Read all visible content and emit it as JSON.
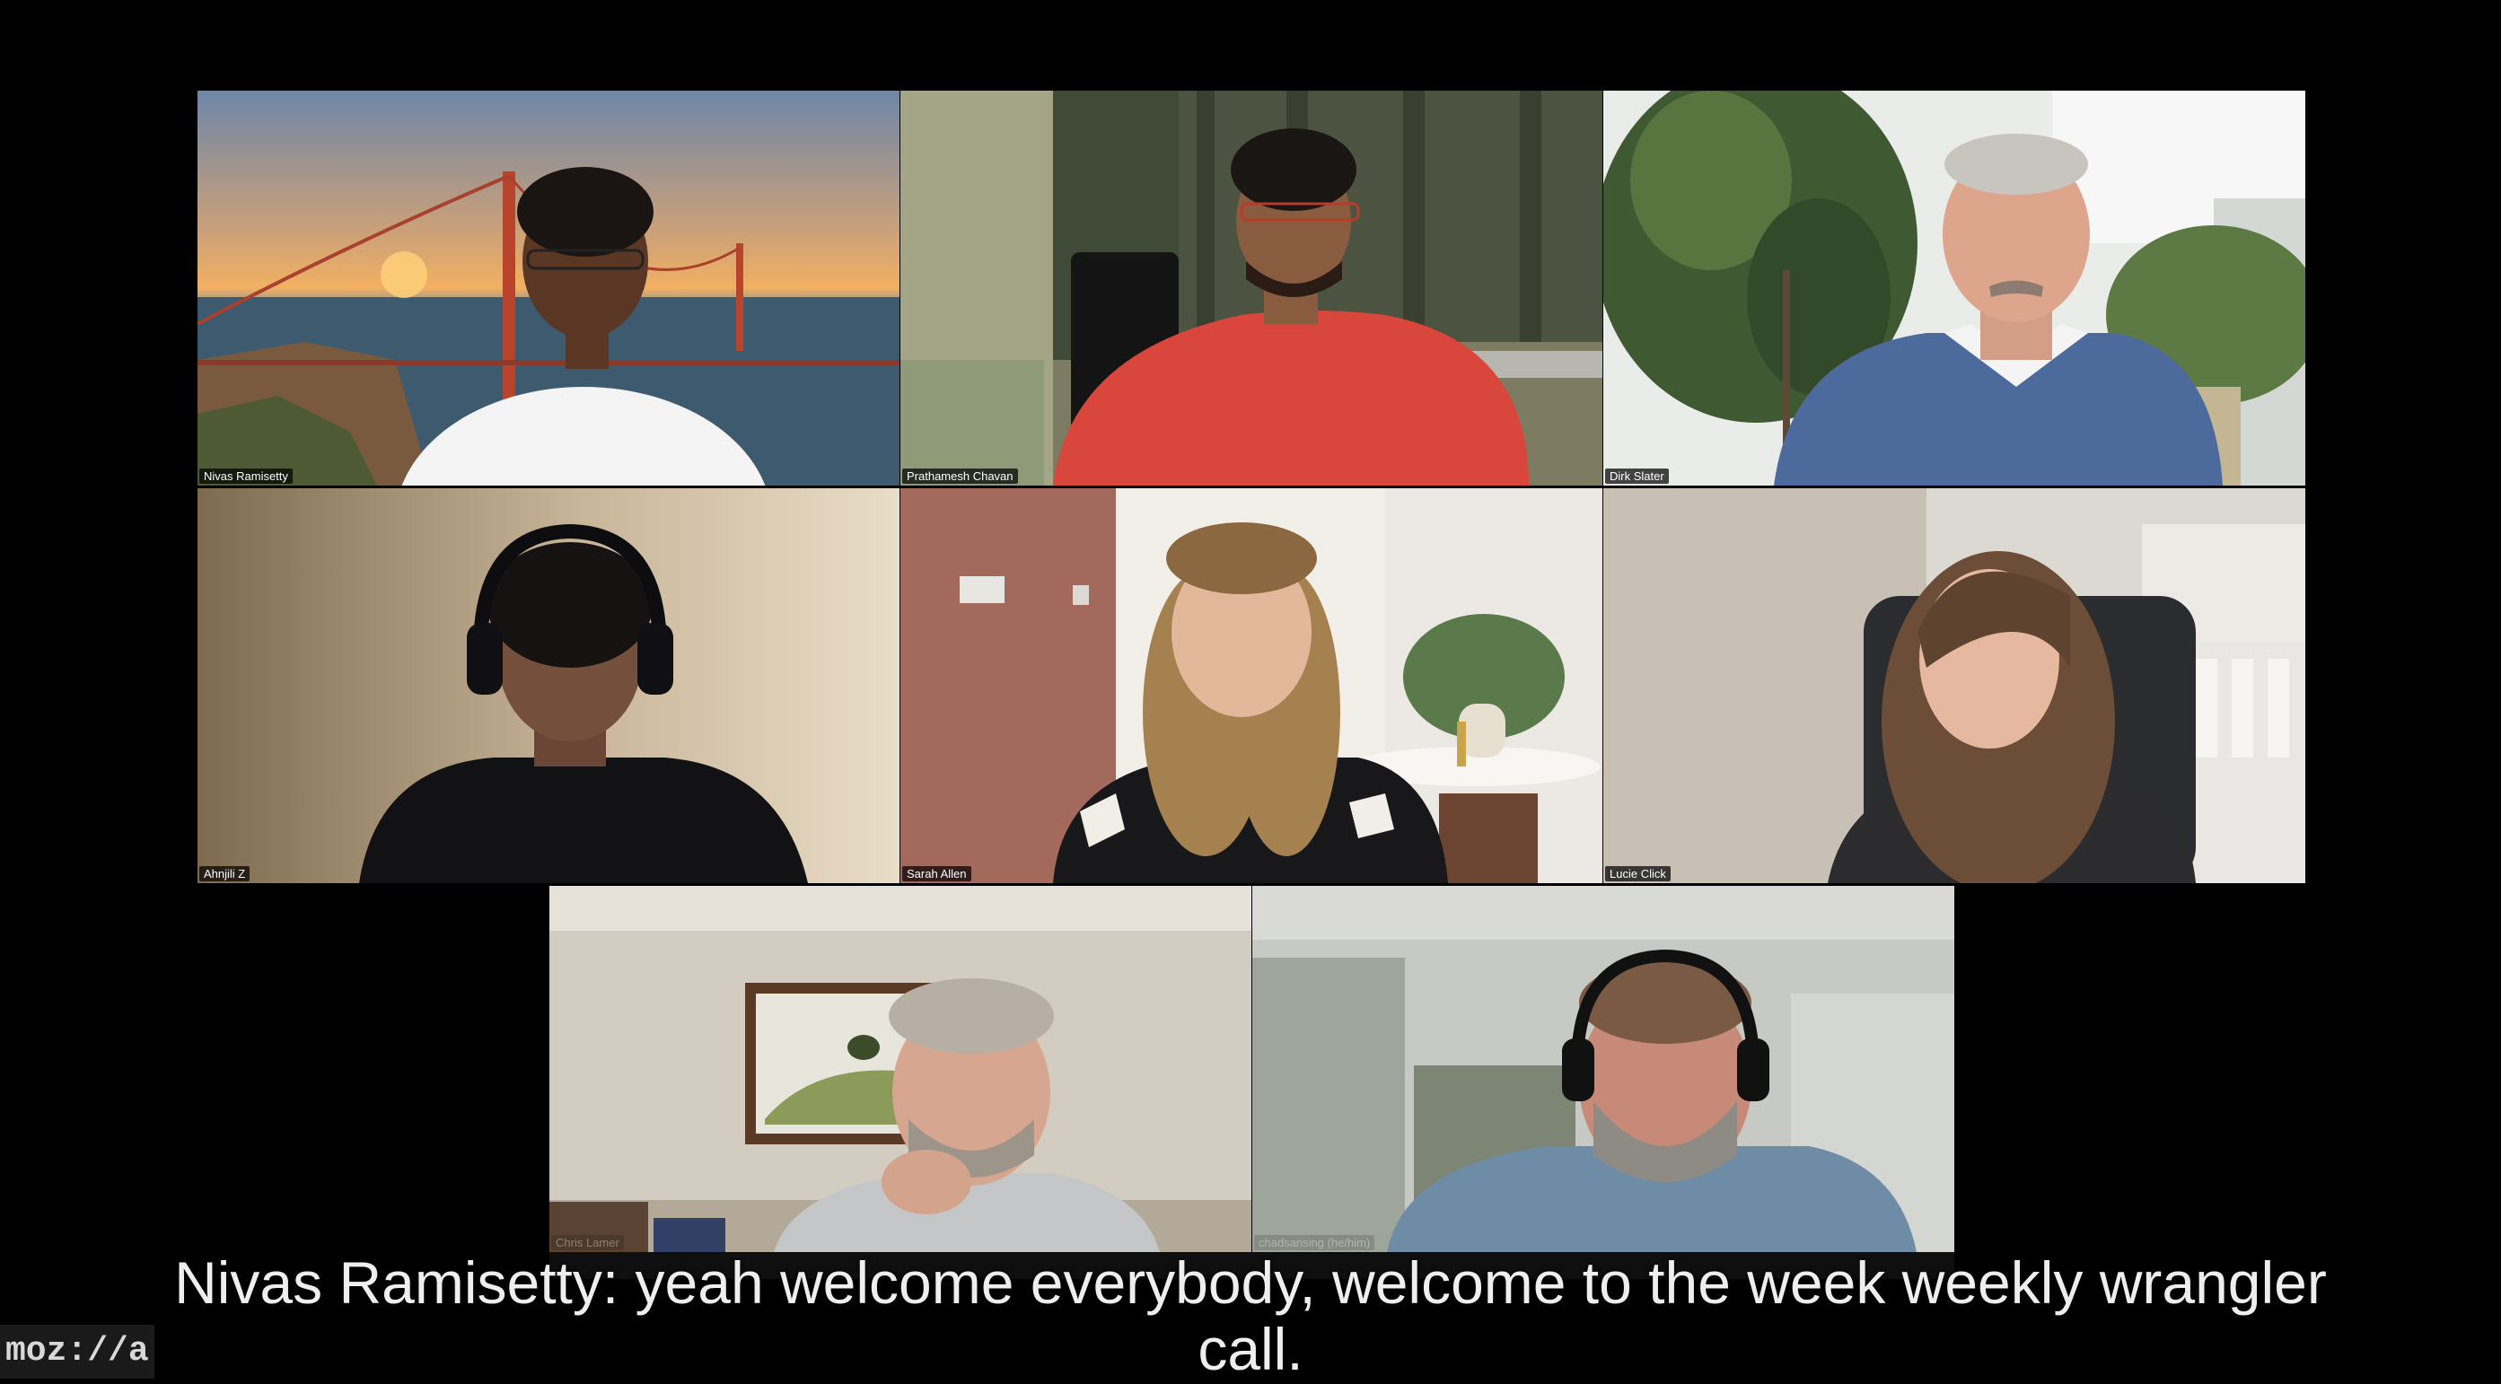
{
  "participants": [
    {
      "name": "Nivas Ramisetty"
    },
    {
      "name": "Prathamesh Chavan"
    },
    {
      "name": "Dirk Slater"
    },
    {
      "name": "Ahnjili Z"
    },
    {
      "name": "Sarah Allen"
    },
    {
      "name": "Lucie Click"
    },
    {
      "name": "Chris Lamer"
    },
    {
      "name": "chadsansing (he/him)"
    }
  ],
  "caption": {
    "text": "Nivas Ramisetty: yeah welcome everybody, welcome to the week weekly wrangler call."
  },
  "logo": {
    "text": "moz://a"
  },
  "colors": {
    "background": "#000000",
    "caption_text": "#eeeeee"
  }
}
